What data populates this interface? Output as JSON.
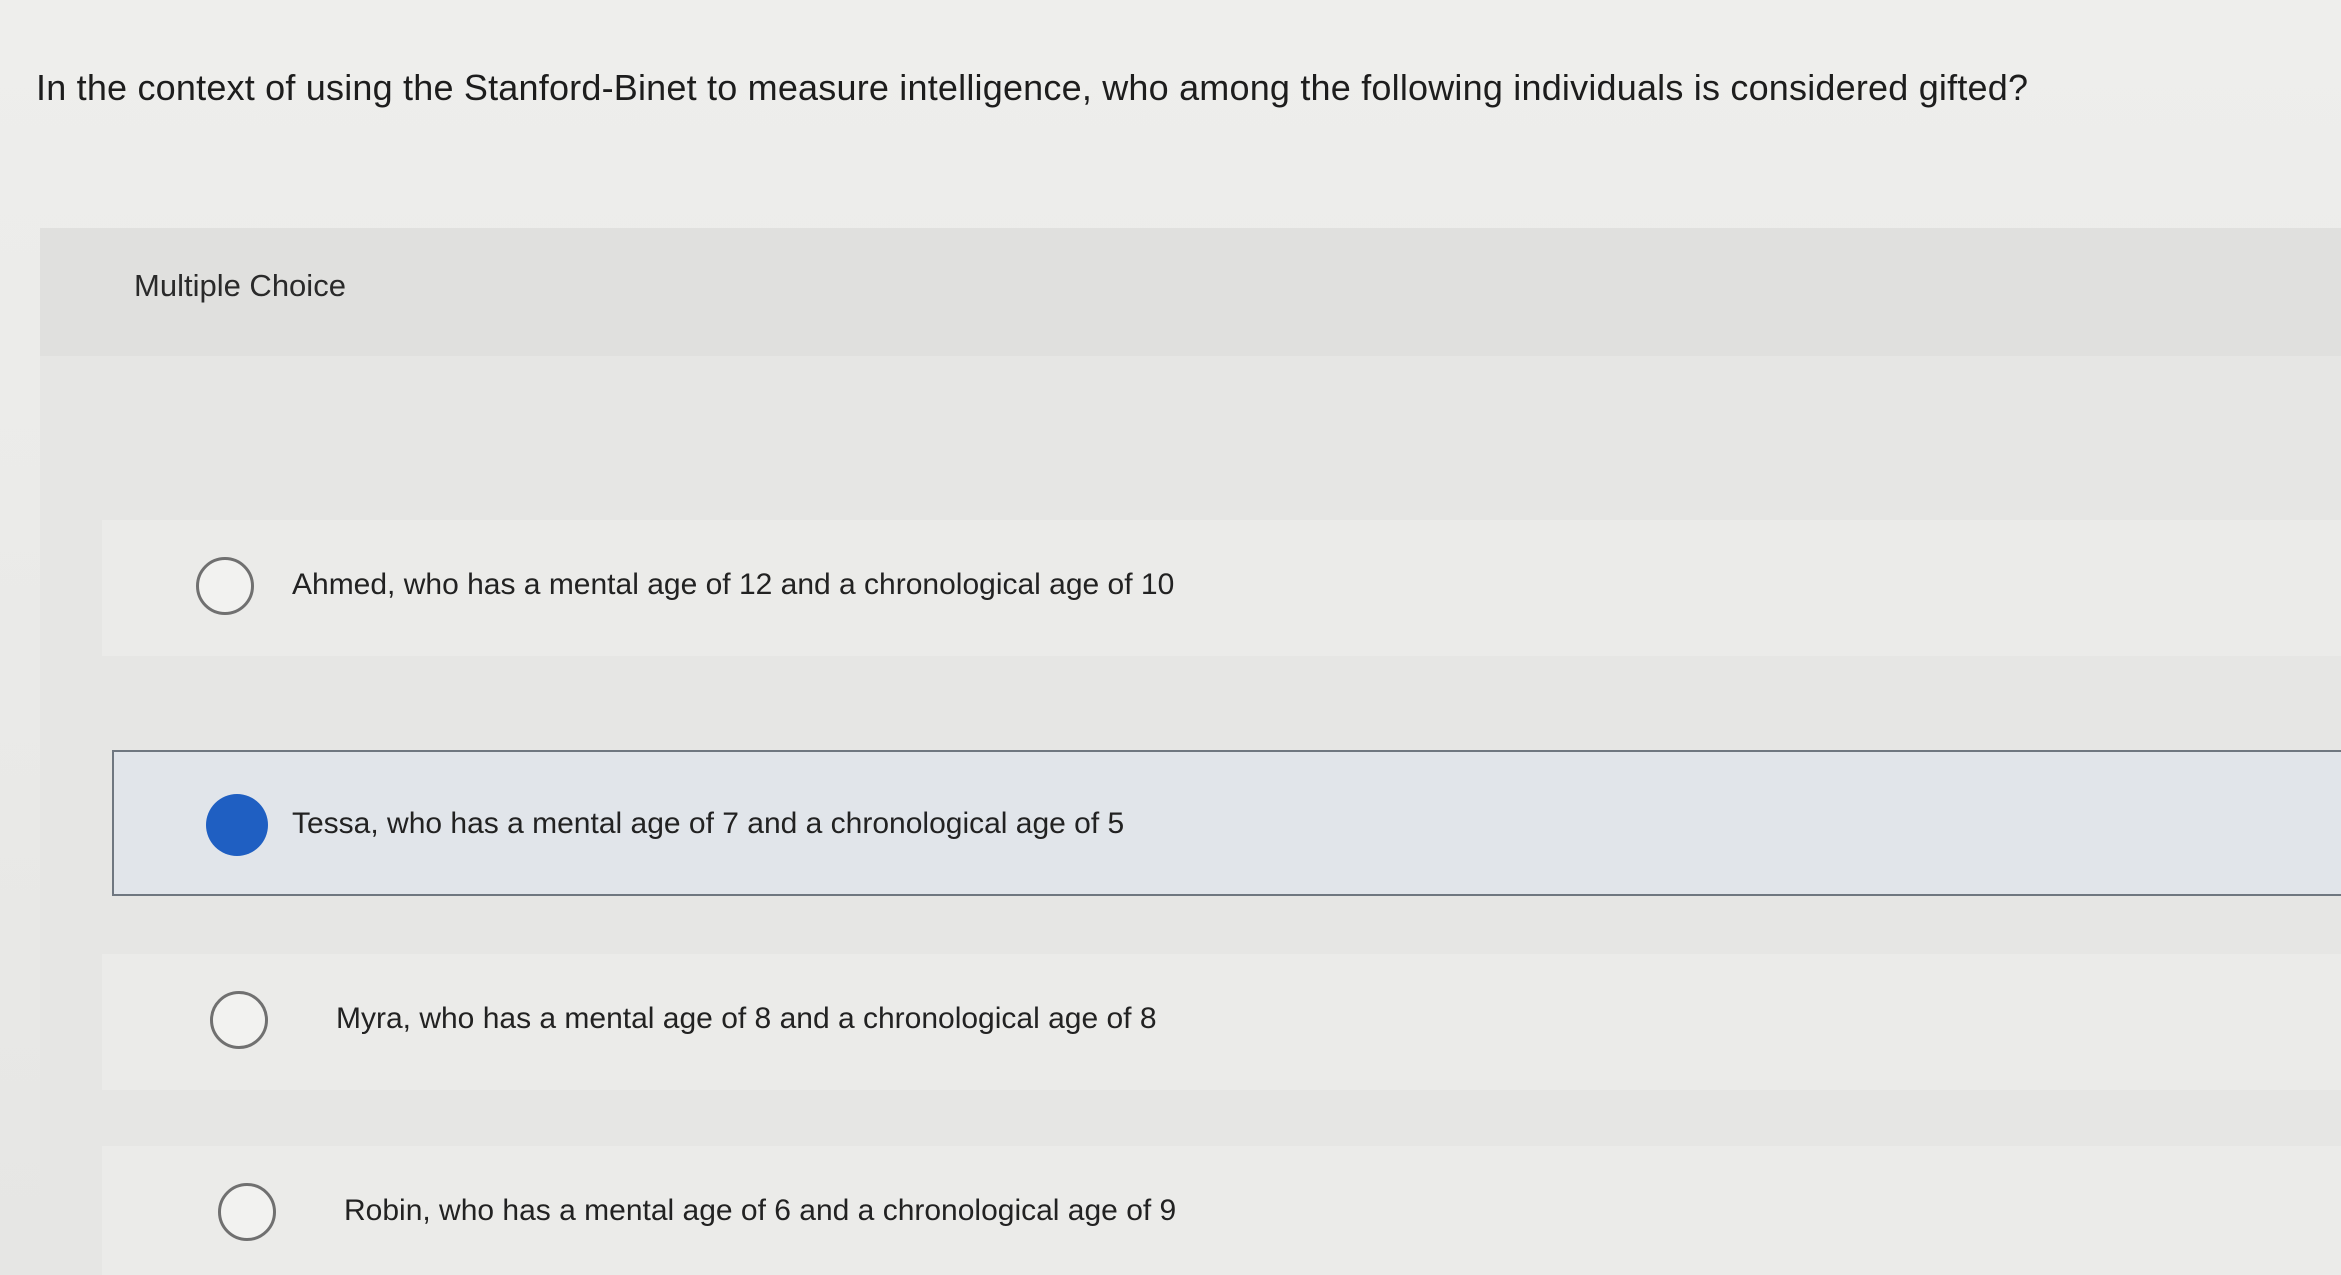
{
  "question": {
    "text": "In the context of using the Stanford-Binet to measure intelligence, who among the following individuals is considered gifted?"
  },
  "panel": {
    "label": "Multiple Choice"
  },
  "options": [
    {
      "text": "Ahmed, who has a mental age of 12 and a chronological age of 10",
      "selected": false
    },
    {
      "text": "Tessa, who has a mental age of 7 and a chronological age of 5",
      "selected": true
    },
    {
      "text": "Myra, who has a mental age of 8 and a chronological age of 8",
      "selected": false
    },
    {
      "text": "Robin, who has a mental age of 6 and a chronological age of 9",
      "selected": false
    }
  ],
  "colors": {
    "selected_radio": "#1f5fc2",
    "selected_background": "#e1e5ea"
  }
}
